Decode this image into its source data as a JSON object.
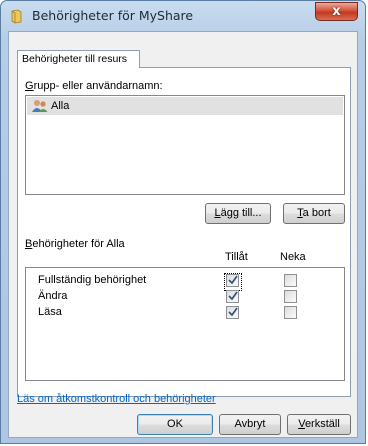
{
  "window": {
    "title": "Behörigheter för MyShare",
    "close_glyph": "x",
    "title_icon": "folder-share-icon"
  },
  "tab": {
    "label": "Behörigheter till resurs"
  },
  "users": {
    "label_mnemonic": "G",
    "label_rest": "rupp- eller användarnamn:",
    "items": [
      {
        "name": "Alla",
        "icon": "user-group-icon",
        "selected": true
      }
    ]
  },
  "buttons": {
    "add_mnemonic": "L",
    "add_rest": "ägg till...",
    "remove_mnemonic": "T",
    "remove_rest": "a bort",
    "ok": "OK",
    "cancel": "Avbryt",
    "apply_mnemonic": "V",
    "apply_rest": "erkställ"
  },
  "permissions": {
    "label_mnemonic": "B",
    "label_rest": "ehörigheter för Alla",
    "col_allow": "Tillåt",
    "col_deny": "Neka",
    "rows": [
      {
        "name": "Fullständig behörighet",
        "allow": true,
        "deny": false
      },
      {
        "name": "Ändra",
        "allow": true,
        "deny": false
      },
      {
        "name": "Läsa",
        "allow": true,
        "deny": false
      }
    ]
  },
  "help_link": "Läs om åtkomstkontroll och behörigheter"
}
